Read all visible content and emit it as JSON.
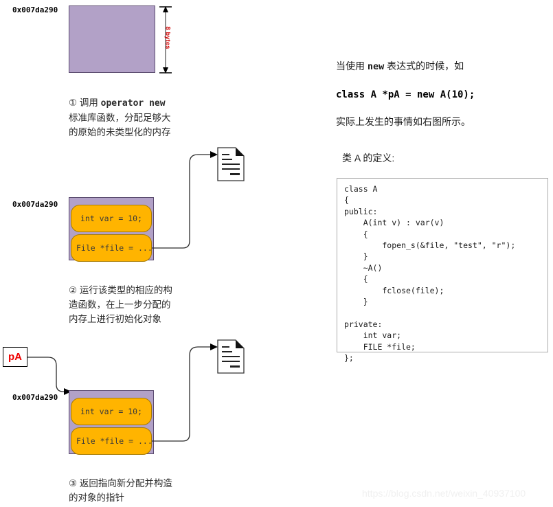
{
  "diagram": {
    "title_hidden": "",
    "addresses": {
      "step1": "0x007da290",
      "step2": "0x007da290",
      "step3": "0x007da290"
    },
    "size_label": "8 bytes",
    "pointer_box_label": "pA",
    "slots": {
      "member_int": "int var = 10;",
      "member_file": "File *file = ..."
    },
    "captions": {
      "step1_num": "①",
      "step1_lead": " 调用 ",
      "step1_mono": "operator new",
      "step1_rest": "\n标准库函数，分配足够大\n的原始的未类型化的内存",
      "step2": "② 运行该类型的相应的构\n造函数，在上一步分配的\n内存上进行初始化对象",
      "step3": "③ 返回指向新分配并构造\n的对象的指针"
    }
  },
  "explanation": {
    "line1_pre": "当使用 ",
    "line1_mono": "new",
    "line1_post": " 表达式的时候，如",
    "code_example": "class A *pA = new A(10);",
    "line3": "实际上发生的事情如右图所示。",
    "class_def_label": "类 A 的定义:",
    "class_code": "class A\n{\npublic:\n    A(int v) : var(v)\n    {\n        fopen_s(&file, \"test\", \"r\");\n    }\n    ~A()\n    {\n        fclose(file);\n    }\n\nprivate:\n    int var;\n    FILE *file;\n};"
  },
  "watermark": "https://blog.csdn.net/weixin_40937100",
  "colors": {
    "memory_purple": "#b2a1c7",
    "member_orange": "#ffb400",
    "pointer_red": "#ee0000",
    "size_label_red": "#d00000"
  }
}
